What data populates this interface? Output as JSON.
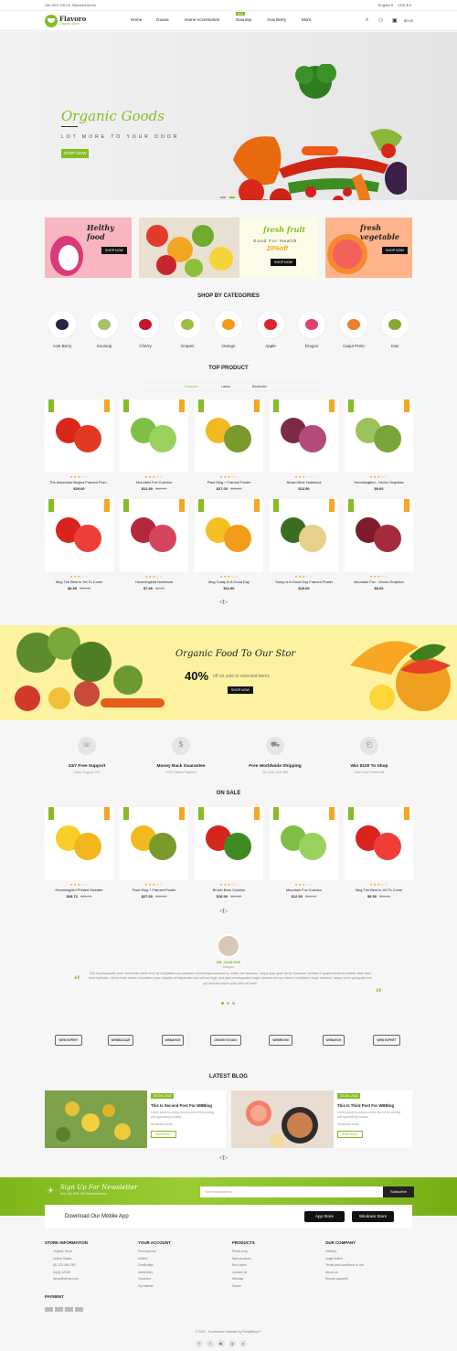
{
  "topbar": {
    "promo": "Get 30% Off On Selected Items",
    "language": "English ▾",
    "currency": "USD $ ▾"
  },
  "header": {
    "logo_name": "Flavoro",
    "logo_sub": "Organic Store",
    "nav": [
      "Home",
      "Guava",
      "Home Accessories",
      "Soursop",
      "Acai Berry",
      "More"
    ],
    "new_tag": "New",
    "cart_amount": "$0.00"
  },
  "hero": {
    "title": "Organic Goods",
    "tagline": "LOT MORE TO YOUR DOOR",
    "button": "SHOP NOW"
  },
  "banners": [
    {
      "title": "Helthy food",
      "button": "SHOP NOW"
    },
    {
      "title": "fresh fruit",
      "line": "Good For Health",
      "offer": "20%off",
      "button": "SHOP NOW"
    },
    {
      "title": "fresh vegetable",
      "button": "SHOP NOW"
    }
  ],
  "categories": {
    "title": "SHOP BY CATEGORIES",
    "items": [
      "Acai Berry",
      "Soursop",
      "Cherry",
      "Grapes",
      "Orange",
      "Apple",
      "Dragon",
      "Caqui Preto",
      "Kiwi"
    ],
    "colors": [
      "#2a2340",
      "#a7c069",
      "#c3152a",
      "#9bbf46",
      "#f49b1b",
      "#d8262a",
      "#e0436a",
      "#f07f2a",
      "#8aa735"
    ]
  },
  "top_product": {
    "title": "TOP PRODUCT",
    "tabs": [
      "Featured",
      "Latest",
      "Bestseller"
    ],
    "rating": "★★★☆☆",
    "products": [
      {
        "name": "The Adventure Begins Framed Post...",
        "price": "$29.00",
        "old": ""
      },
      {
        "name": "Mountain Fox Cushion",
        "price": "$12.90",
        "old": "$18.90"
      },
      {
        "name": "Pack Mug + Framed Poster",
        "price": "$27.00",
        "old": "$35.00"
      },
      {
        "name": "Brown Bear Notebook",
        "price": "$12.90",
        "old": ""
      },
      {
        "name": "Hummingbird - Vector Graphics",
        "price": "$9.00",
        "old": ""
      },
      {
        "name": "Mug The Best Is Yet To Come",
        "price": "$9.90",
        "old": "$11.90"
      },
      {
        "name": "Hummingbird Notebook",
        "price": "$7.90",
        "old": "$9.90"
      },
      {
        "name": "Mug Today Is A Good Day",
        "price": "$11.90",
        "old": ""
      },
      {
        "name": "Today Is A Good Day Framed Poster",
        "price": "$29.00",
        "old": ""
      },
      {
        "name": "Mountain Fox - Vector Graphics",
        "price": "$9.00",
        "old": ""
      }
    ],
    "nav": "◁▷"
  },
  "promo": {
    "title": "Organic Food To Our Stor",
    "percent": "40%",
    "text": "off on sale to selected items",
    "button": "SHOP NOW"
  },
  "features": [
    {
      "title": "24/7 Free Support",
      "sub": "Online Support 24/7"
    },
    {
      "title": "Money Back Guarantee",
      "sub": "100% Secure Payment"
    },
    {
      "title": "Free Worldwide Shipping",
      "sub": "On Order Over $99"
    },
    {
      "title": "Win $100 To Shop",
      "sub": "Enter Now Perfect Gift"
    }
  ],
  "on_sale": {
    "title": "ON SALE",
    "products": [
      {
        "name": "Hummingbird Printed Sweater",
        "price": "$28.72",
        "old": "$35.90"
      },
      {
        "name": "Pack Mug + Framed Poster",
        "price": "$27.00",
        "old": "$35.00"
      },
      {
        "name": "Brown Bear Cushion",
        "price": "$18.90",
        "old": "$21.90"
      },
      {
        "name": "Mountain Fox Cushion",
        "price": "$12.90",
        "old": "$18.90"
      },
      {
        "name": "Mug The Best Is Yet To Come",
        "price": "$9.90",
        "old": "$11.90"
      }
    ]
  },
  "testimonial": {
    "name": "MR. JOHN DOE",
    "role": "Designer",
    "text": "Sed ut perspiciatis unde omnis iste natus error sit voluptatem accusantium doloremque laudantium, totam rem aperiam, eaque ipsa quae ab illo inventore veritatis et quasi architecto beatae vitae dicta sunt explicabo. Nemo enim ipsam voluptatem quia voluptas sit aspernatur aut odit aut fugit, sed quia consequuntur magni dolores eos qui ratione voluptatem sequi nesciunt. Neque porro quisquam est, qui dolorem ipsum quia dolor sit amet."
  },
  "brands": [
    "WEB EXPERT",
    "WEBBAZAAR",
    "WEBARCH",
    "DESIGN STUDIO",
    "WEBROOM",
    "WEBARCH",
    "WEB EXPERT"
  ],
  "blog": {
    "title": "LATEST BLOG",
    "posts": [
      {
        "date": "08 Oct, 2018",
        "title": "This Is Second Post For WBBlog",
        "body": "Lorem ipsum is simply dummy text of the printing and typesetting industry",
        "author": "Webazaar admin",
        "more": "Read More »"
      },
      {
        "date": "08 Oct, 2018",
        "title": "This Is Third Post For WBBlog",
        "body": "Lorem ipsum is simply dummy text of the printing and typesetting industry",
        "author": "Webazaar admin",
        "more": "Read More »"
      }
    ]
  },
  "newsletter": {
    "title": "Sign Up For Newsletter",
    "sub": "And Get 30% Off Selected Items",
    "placeholder": "Your email address",
    "button": "Subscribe"
  },
  "app": {
    "title": "Download Our Mobile App",
    "appstore": "App Store",
    "windows": "Windows Store"
  },
  "footer": {
    "store": {
      "title": "STORE INFORMATION",
      "lines": [
        "Organic Store",
        "United States",
        "(8) 123-456-789",
        "(1)(4) 12345",
        "demo@demo.com"
      ]
    },
    "account": {
      "title": "YOUR ACCOUNT",
      "lines": [
        "Personal info",
        "Orders",
        "Credit slips",
        "Addresses",
        "Vouchers",
        "My wishlist"
      ]
    },
    "products": {
      "title": "PRODUCTS",
      "lines": [
        "Prices drop",
        "New products",
        "Best sales",
        "Contact us",
        "Sitemap",
        "Stores"
      ]
    },
    "company": {
      "title": "OUR COMPANY",
      "lines": [
        "Delivery",
        "Legal Notice",
        "Terms and conditions of use",
        "About us",
        "Secure payment"
      ]
    },
    "payment": "PAYMENT",
    "copyright": "© 2020 - Ecommerce software by PrestaShop™",
    "social": [
      "f",
      "t",
      "▶",
      "g",
      "p"
    ]
  }
}
